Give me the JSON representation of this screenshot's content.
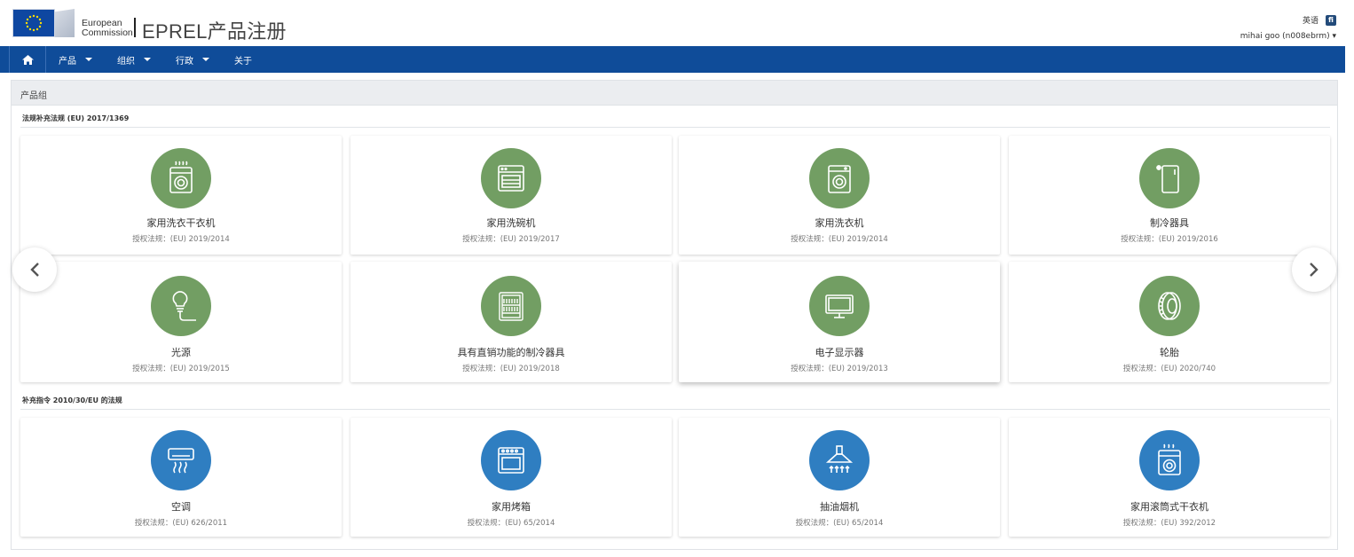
{
  "header": {
    "org_line1": "European",
    "org_line2": "Commission",
    "app_title": "EPREL产品注册",
    "language": "英语",
    "language_badge": "fi",
    "user": "mihai goo (n008ebrm) ▾"
  },
  "nav": {
    "items": [
      {
        "label": "产品",
        "dropdown": true
      },
      {
        "label": "组织",
        "dropdown": true
      },
      {
        "label": "行政",
        "dropdown": true
      },
      {
        "label": "关于",
        "dropdown": false
      }
    ]
  },
  "panel": {
    "title": "产品组"
  },
  "sections": [
    {
      "label": "法规补充法规 (EU) 2017/1369",
      "cards": [
        {
          "name": "家用洗衣干衣机",
          "reg": "授权法规：(EU) 2019/2014",
          "icon": "washer-dryer-icon",
          "color": "green"
        },
        {
          "name": "家用洗碗机",
          "reg": "授权法规：(EU) 2019/2017",
          "icon": "dishwasher-icon",
          "color": "green"
        },
        {
          "name": "家用洗衣机",
          "reg": "授权法规：(EU) 2019/2014",
          "icon": "washing-machine-icon",
          "color": "green"
        },
        {
          "name": "制冷器具",
          "reg": "授权法规：(EU) 2019/2016",
          "icon": "refrigerator-icon",
          "color": "green"
        },
        {
          "name": "光源",
          "reg": "授权法规：(EU) 2019/2015",
          "icon": "light-bulb-icon",
          "color": "green"
        },
        {
          "name": "具有直销功能的制冷器具",
          "reg": "授权法规：(EU) 2019/2018",
          "icon": "vending-fridge-icon",
          "color": "green"
        },
        {
          "name": "电子显示器",
          "reg": "授权法规：(EU) 2019/2013",
          "icon": "monitor-icon",
          "color": "green"
        },
        {
          "name": "轮胎",
          "reg": "授权法规：(EU) 2020/740",
          "icon": "tyre-icon",
          "color": "green"
        }
      ]
    },
    {
      "label": "补充指令 2010/30/EU 的法规",
      "cards": [
        {
          "name": "空调",
          "reg": "授权法规：(EU) 626/2011",
          "icon": "air-conditioner-icon",
          "color": "blue"
        },
        {
          "name": "家用烤箱",
          "reg": "授权法规：(EU) 65/2014",
          "icon": "oven-icon",
          "color": "blue"
        },
        {
          "name": "抽油烟机",
          "reg": "授权法规：(EU) 65/2014",
          "icon": "range-hood-icon",
          "color": "blue"
        },
        {
          "name": "家用滚筒式干衣机",
          "reg": "授权法规：(EU) 392/2012",
          "icon": "tumble-dryer-icon",
          "color": "blue"
        }
      ]
    }
  ],
  "colors": {
    "nav_blue": "#0f4c99",
    "green_icon": "#729e63",
    "blue_icon": "#2f7ec1"
  }
}
